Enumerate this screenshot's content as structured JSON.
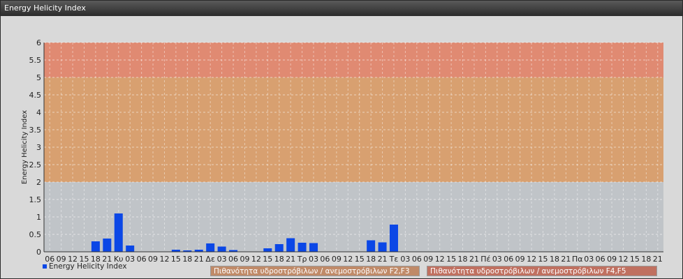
{
  "window": {
    "title": "Energy Helicity Index"
  },
  "colors": {
    "bar": "#0b47e6",
    "zone_low": "#c0c4c8",
    "zone_mid": "#d8a070",
    "zone_high": "#e08a72",
    "zone_label_mid": "#c08a68",
    "zone_label_high": "#c07060"
  },
  "legend": {
    "series_label": "Energy Helicity Index",
    "zones": [
      {
        "label": "Πιθανότητα υδροστρόβιλων / ανεμοστρόβιλων F2,F3",
        "color": "#c08a68"
      },
      {
        "label": "Πιθανότητα υδροστρόβιλων / ανεμοστρόβιλων F4,F5",
        "color": "#c07060"
      }
    ]
  },
  "chart_data": {
    "type": "bar",
    "title": "Energy Helicity Index",
    "xlabel": "",
    "ylabel": "Energy Helicity Index",
    "ylim": [
      0,
      6
    ],
    "yticks": [
      "0",
      "0.5",
      "1",
      "1.5",
      "2",
      "2.5",
      "3",
      "3.5",
      "4",
      "4.5",
      "5",
      "5.5",
      "6"
    ],
    "grid": true,
    "legend_position": "bottom-left",
    "zones": [
      {
        "from": 0,
        "to": 2,
        "color": "#c0c4c8"
      },
      {
        "from": 2,
        "to": 5,
        "color": "#d8a070"
      },
      {
        "from": 5,
        "to": 6,
        "color": "#e08a72"
      }
    ],
    "categories": [
      "06",
      "09",
      "12",
      "15",
      "18",
      "21",
      "Κυ",
      "03",
      "06",
      "09",
      "12",
      "15",
      "18",
      "21",
      "Δε",
      "03",
      "06",
      "09",
      "12",
      "15",
      "18",
      "21",
      "Τρ",
      "03",
      "06",
      "09",
      "12",
      "15",
      "18",
      "21",
      "Τε",
      "03",
      "06",
      "09",
      "12",
      "15",
      "18",
      "21",
      "Πέ",
      "03",
      "06",
      "09",
      "12",
      "15",
      "18",
      "21",
      "Πα",
      "03",
      "06",
      "09",
      "12",
      "15",
      "18",
      "21"
    ],
    "series": [
      {
        "name": "Energy Helicity Index",
        "values": [
          0.01,
          0.01,
          0.01,
          0.01,
          0.3,
          0.38,
          1.1,
          0.18,
          0.01,
          0.01,
          0.01,
          0.06,
          0.04,
          0.06,
          0.24,
          0.15,
          0.05,
          0.01,
          0.01,
          0.1,
          0.22,
          0.39,
          0.26,
          0.25,
          0.01,
          0.01,
          0.01,
          0.01,
          0.33,
          0.27,
          0.78,
          0.01,
          0.01,
          0.01,
          0.01,
          0.01,
          0.01,
          0.01,
          0.01,
          0.01,
          0.01,
          0.01,
          0.01,
          0.01,
          0.01,
          0.01,
          0.01,
          0.01,
          0.01,
          0.01,
          0.01,
          0.01,
          0.01,
          0.01
        ]
      }
    ]
  }
}
